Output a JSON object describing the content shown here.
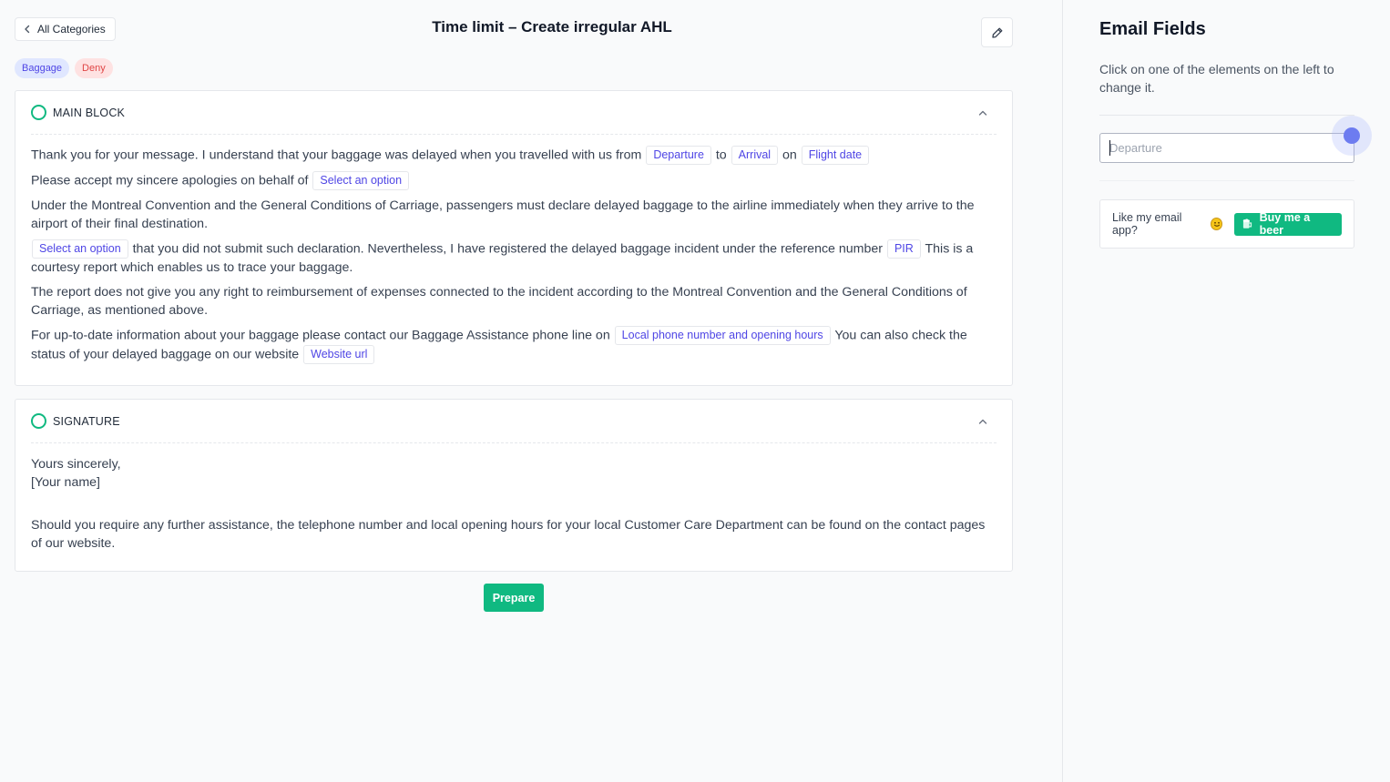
{
  "header": {
    "back_label": "All Categories",
    "title": "Time limit – Create irregular AHL"
  },
  "tags": [
    "Baggage",
    "Deny"
  ],
  "main_block": {
    "title": "MAIN BLOCK",
    "line1_a": "Thank you for your message. I understand that your baggage was delayed when you travelled with us from",
    "chip_departure": "Departure",
    "line1_b": "to",
    "chip_arrival": "Arrival",
    "line1_c": "on",
    "chip_flight_date": "Flight date",
    "line2_a": "Please accept my sincere apologies on behalf of",
    "chip_select1": "Select an option",
    "line3": "Under the Montreal Convention and the General Conditions of Carriage, passengers must declare delayed baggage to the airline immediately when they arrive to the airport of their final destination.",
    "chip_select2": "Select an option",
    "line4_a": "that you did not submit such declaration. Nevertheless, I have registered the delayed baggage incident under the reference number",
    "chip_pir": "PIR",
    "line4_b": "This is a courtesy report which enables us to trace your baggage.",
    "line5": "The report does not give you any right to reimbursement of expenses connected to the incident according to the Montreal Convention and the General Conditions of Carriage, as mentioned above.",
    "line6_a": "For up-to-date information about your baggage please contact our Baggage Assistance phone line on",
    "chip_phone": "Local phone number and opening hours",
    "line6_b": "You can also check the status of your delayed baggage on our website",
    "chip_website": "Website url"
  },
  "signature": {
    "title": "SIGNATURE",
    "line1": "Yours sincerely,",
    "line2": "[Your name]",
    "line3": "Should you require any further assistance, the telephone number and local opening hours for your local Customer Care Department can be found on the contact pages of our website."
  },
  "prepare_label": "Prepare",
  "sidebar": {
    "title": "Email Fields",
    "description": "Click on one of the elements on the left to change it.",
    "input_placeholder": "Departure",
    "input_value": "",
    "promo_text": "Like my email app?",
    "beer_label": "Buy me a beer"
  },
  "colors": {
    "accent_green": "#10b981",
    "accent_indigo": "#4f46e5",
    "tag_baggage_bg": "#e0e7ff",
    "tag_deny_bg": "#fee2e2"
  }
}
